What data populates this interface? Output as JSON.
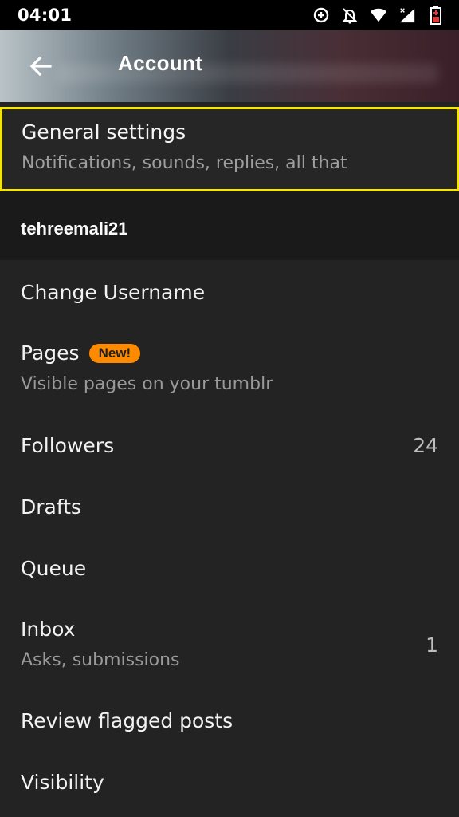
{
  "status_bar": {
    "time": "04:01",
    "icons": [
      "data-saver-icon",
      "notifications-off-icon",
      "wifi-icon",
      "signal-icon",
      "battery-icon"
    ]
  },
  "header": {
    "title": "Account",
    "back_icon": "arrow-left-icon"
  },
  "general_settings": {
    "title": "General settings",
    "subtitle": "Notifications, sounds, replies, all that",
    "highlight_color": "#f5e60a"
  },
  "blog": {
    "username": "tehreemali21"
  },
  "menu": {
    "change_username": "Change Username",
    "pages": {
      "label": "Pages",
      "badge": "New!",
      "subtitle": "Visible pages on your tumblr"
    },
    "followers": {
      "label": "Followers",
      "count": "24"
    },
    "drafts": "Drafts",
    "queue": "Queue",
    "inbox": {
      "label": "Inbox",
      "subtitle": "Asks, submissions",
      "count": "1"
    },
    "review_flagged": "Review flagged posts",
    "visibility": "Visibility"
  },
  "colors": {
    "background": "#232323",
    "badge": "#ff8a00"
  }
}
